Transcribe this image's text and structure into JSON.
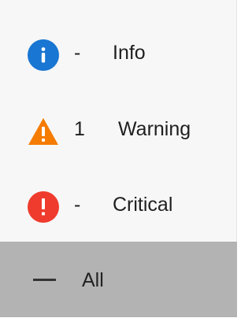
{
  "filters": {
    "info": {
      "icon": "info-icon",
      "count": "-",
      "label": "Info",
      "color": "#1976D2"
    },
    "warning": {
      "icon": "warning-icon",
      "count": "1",
      "label": "Warning",
      "color": "#F57C00"
    },
    "critical": {
      "icon": "critical-icon",
      "count": "-",
      "label": "Critical",
      "color": "#EF3B2D"
    },
    "all": {
      "icon": "dash-icon",
      "label": "All",
      "selected": true
    }
  }
}
